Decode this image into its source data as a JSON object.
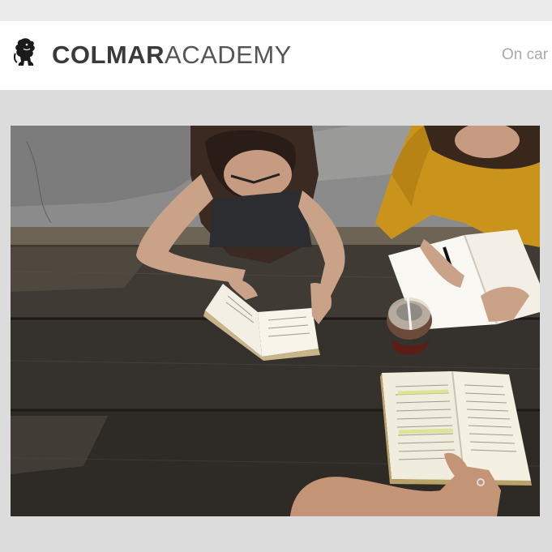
{
  "header": {
    "brand_bold": "COLMAR",
    "brand_light": "ACADEMY",
    "logo_icon": "lion-rampant-icon",
    "nav_partial": "On car"
  },
  "hero": {
    "description_icon": "students-studying-at-table-photo"
  },
  "colors": {
    "page_background": "#dcdcdc",
    "header_background": "#ffffff",
    "brand_text": "#3a3a3a",
    "nav_text": "#a8a8a8"
  }
}
